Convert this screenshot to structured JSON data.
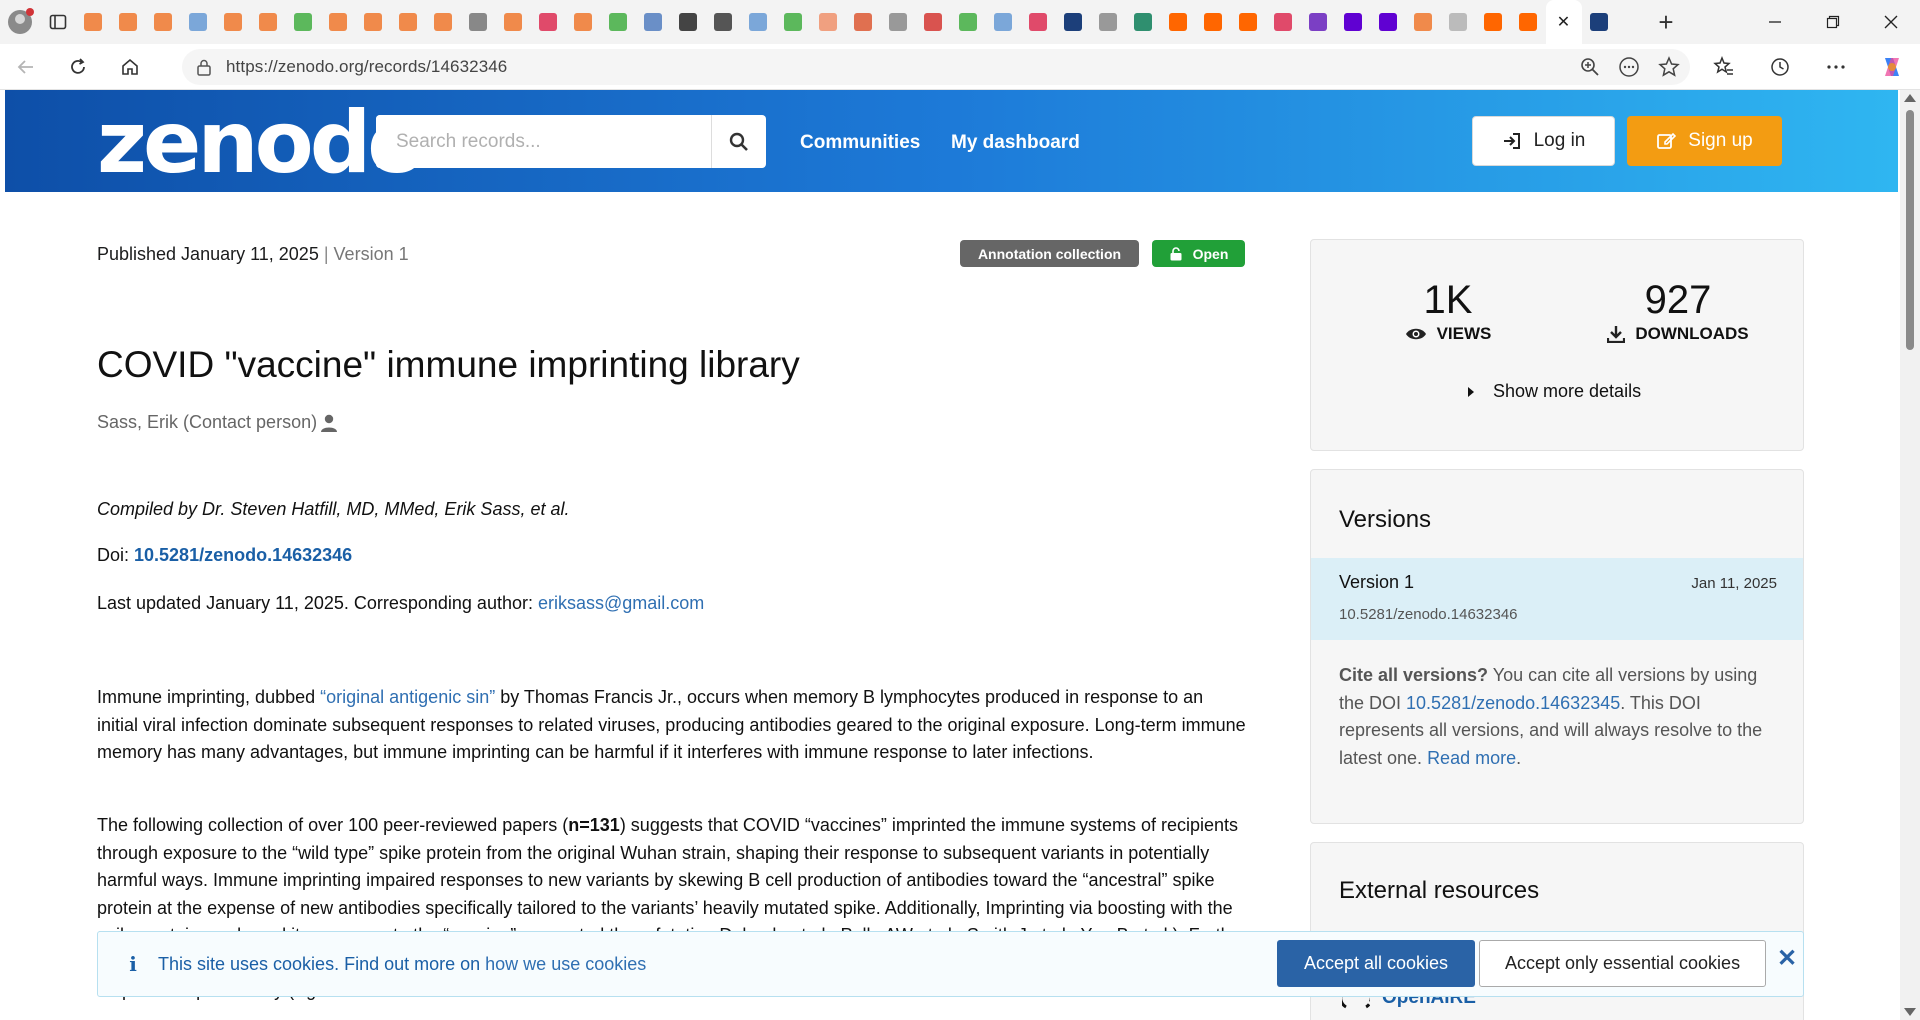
{
  "browser": {
    "tab_favicon_colors": [
      "#f08a4b",
      "#f08a4b",
      "#f08a4b",
      "#7ba7d9",
      "#f08a4b",
      "#f08a4b",
      "#5cb85c",
      "#f08a4b",
      "#f08a4b",
      "#f08a4b",
      "#f08a4b",
      "#888888",
      "#f08a4b",
      "#e04a6a",
      "#f08a4b",
      "#5cb85c",
      "#6a8fc7",
      "#444444",
      "#555555",
      "#7ba7d9",
      "#5cb85c",
      "#f0a080",
      "#e07050",
      "#999999",
      "#d9534f",
      "#5cb85c",
      "#7ba7d9",
      "#e04a6a",
      "#1c3f7a",
      "#999999",
      "#2f8f6f",
      "#ff6600",
      "#ff6600",
      "#ff6600",
      "#e04a6a",
      "#7b3fc4",
      "#6001d2",
      "#6001d2",
      "#f08a4b",
      "#bbbbbb",
      "#ff6600",
      "#ff6600"
    ],
    "active_tab_close": "✕",
    "extra_tab_favicon_color": "#1c3f7a",
    "new_tab_label": "+",
    "url": "https://zenodo.org/records/14632346"
  },
  "header": {
    "logo": "zenodo",
    "search_placeholder": "Search records...",
    "nav": [
      "Communities",
      "My dashboard"
    ],
    "login_label": "Log in",
    "signup_label": "Sign up",
    "colors": {
      "signup": "#f39c12",
      "header_start": "#0e4fa8",
      "header_end": "#2fb6f1"
    }
  },
  "record": {
    "published": "Published January 11, 2025",
    "separator": "|",
    "version": "Version 1",
    "badges": {
      "type": "Annotation collection",
      "access": "Open"
    },
    "title": "COVID \"vaccine\" immune imprinting library",
    "author": "Sass, Erik (Contact person)",
    "compiled": "Compiled by Dr. Steven Hatfill, MD, MMed, Erik Sass, et al.",
    "doi_label": "Doi: ",
    "doi": "10.5281/zenodo.14632346",
    "updated_text": "Last updated January 11, 2025. Corresponding author: ",
    "email": "eriksass@gmail.com",
    "p1_a": "Immune imprinting, dubbed ",
    "p1_link": "“original antigenic sin”",
    "p1_b": " by Thomas Francis Jr., occurs when memory B lymphocytes produced in response to an initial viral infection dominate subsequent responses to related viruses, producing antibodies geared to the original exposure. Long-term immune memory has many advantages, but immune imprinting can be harmful if it interferes with immune response to later infections.",
    "p2_a": "The following collection of over 100 peer-reviewed papers (",
    "p2_bold": "n=131",
    "p2_b": ") suggests that COVID “vaccines” imprinted the immune systems of recipients through exposure to the “wild type” spike protein from the original Wuhan strain, shaping their response to subsequent variants in potentially harmful ways. Immune imprinting impaired responses to new variants by skewing B cell production of antibodies toward the “ancestral” spike protein at the expense of new antibodies specifically tailored to the variants’ heavily mutated spike. Additionally, Imprinting via boosting with the spike protein weakened its response to the “vaccine” suggested the refutation Delgado et al., Palla AW et al., Smith J et al., Yue B et al.). Further findings point to “deep immunological imprinting” or “hybrid immune damping,” in which “vaccination” combined with infection alters later immune response unpredictably (Aguilar-Bretones M et al."
  },
  "sidebar": {
    "views_num": "1K",
    "views_label": "VIEWS",
    "downloads_num": "927",
    "downloads_label": "DOWNLOADS",
    "more_details": "Show more details",
    "versions_title": "Versions",
    "version_item": {
      "name": "Version 1",
      "date": "Jan 11, 2025",
      "doi": "10.5281/zenodo.14632346"
    },
    "cite_bold": "Cite all versions?",
    "cite_a": " You can cite all versions by using the DOI ",
    "cite_doi": "10.5281/zenodo.14632345",
    "cite_b": ". This DOI represents all versions, and will always resolve to the latest one. ",
    "read_more": "Read more",
    "cite_end": ".",
    "external_title": "External resources",
    "openaire": "OpenAIRE"
  },
  "cookie": {
    "text": "This site uses cookies. Find out more on ",
    "link": "how we use cookies",
    "accept_all": "Accept all cookies",
    "accept_essential": "Accept only essential cookies",
    "close": "✕"
  }
}
